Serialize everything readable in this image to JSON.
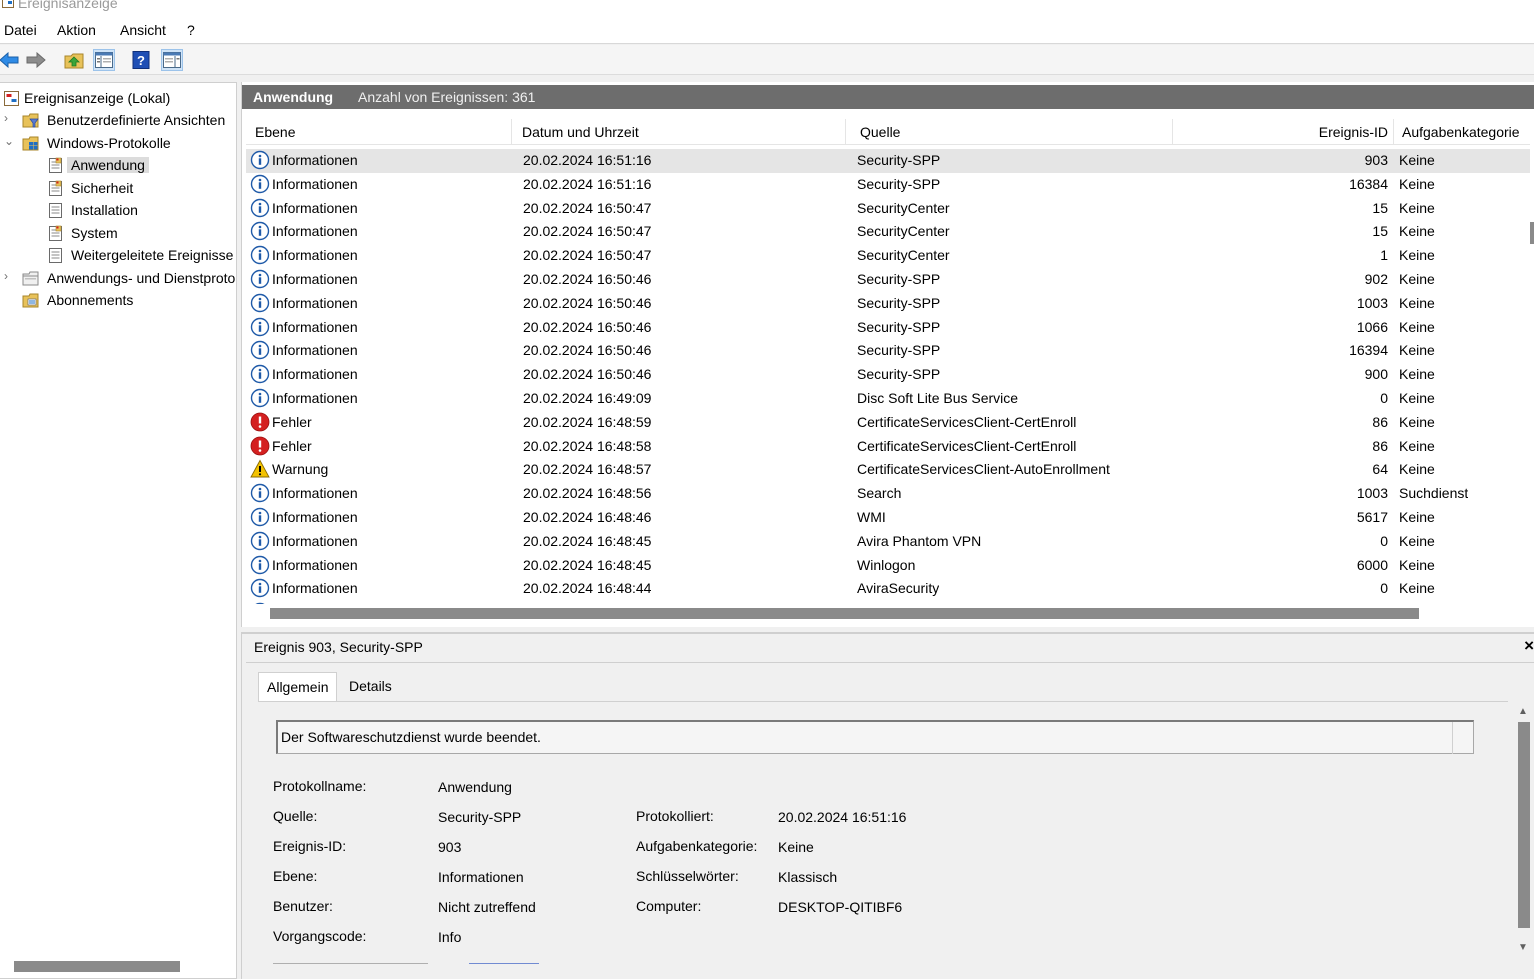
{
  "window": {
    "title": "Ereignisanzeige"
  },
  "menu": {
    "items": [
      "Datei",
      "Aktion",
      "Ansicht",
      "?"
    ]
  },
  "toolbar": {
    "buttons": [
      "back-arrow-icon",
      "forward-arrow-icon",
      "folder-up-icon",
      "show-hide-console-tree-icon",
      "help-icon",
      "show-hide-action-pane-icon"
    ]
  },
  "tree": {
    "items": [
      {
        "label": "Ereignisanzeige (Lokal)",
        "icon": "event-viewer-icon",
        "level": 0,
        "expander": ""
      },
      {
        "label": "Benutzerdefinierte Ansichten",
        "icon": "folder-filter-icon",
        "level": 1,
        "expander": "›"
      },
      {
        "label": "Windows-Protokolle",
        "icon": "folder-windows-icon",
        "level": 1,
        "expander": "⌄"
      },
      {
        "label": "Anwendung",
        "icon": "log-icon",
        "level": 2,
        "expander": "",
        "selected": true
      },
      {
        "label": "Sicherheit",
        "icon": "log-icon",
        "level": 2,
        "expander": ""
      },
      {
        "label": "Installation",
        "icon": "log-plain-icon",
        "level": 2,
        "expander": ""
      },
      {
        "label": "System",
        "icon": "log-icon",
        "level": 2,
        "expander": ""
      },
      {
        "label": "Weitergeleitete Ereignisse",
        "icon": "log-plain-icon",
        "level": 2,
        "expander": ""
      },
      {
        "label": "Anwendungs- und Dienstprotokolle",
        "icon": "folder-icon",
        "level": 1,
        "expander": "›"
      },
      {
        "label": "Abonnements",
        "icon": "subscriptions-icon",
        "level": 1,
        "expander": ""
      }
    ]
  },
  "list": {
    "log_name": "Anwendung",
    "event_count": "Anzahl von Ereignissen: 361",
    "columns": [
      "Ebene",
      "Datum und Uhrzeit",
      "Quelle",
      "Ereignis-ID",
      "Aufgabenkategorie"
    ],
    "rows": [
      {
        "level": "Informationen",
        "type": "info",
        "date": "20.02.2024 16:51:16",
        "source": "Security-SPP",
        "id": "903",
        "category": "Keine"
      },
      {
        "level": "Informationen",
        "type": "info",
        "date": "20.02.2024 16:51:16",
        "source": "Security-SPP",
        "id": "16384",
        "category": "Keine"
      },
      {
        "level": "Informationen",
        "type": "info",
        "date": "20.02.2024 16:50:47",
        "source": "SecurityCenter",
        "id": "15",
        "category": "Keine"
      },
      {
        "level": "Informationen",
        "type": "info",
        "date": "20.02.2024 16:50:47",
        "source": "SecurityCenter",
        "id": "15",
        "category": "Keine"
      },
      {
        "level": "Informationen",
        "type": "info",
        "date": "20.02.2024 16:50:47",
        "source": "SecurityCenter",
        "id": "1",
        "category": "Keine"
      },
      {
        "level": "Informationen",
        "type": "info",
        "date": "20.02.2024 16:50:46",
        "source": "Security-SPP",
        "id": "902",
        "category": "Keine"
      },
      {
        "level": "Informationen",
        "type": "info",
        "date": "20.02.2024 16:50:46",
        "source": "Security-SPP",
        "id": "1003",
        "category": "Keine"
      },
      {
        "level": "Informationen",
        "type": "info",
        "date": "20.02.2024 16:50:46",
        "source": "Security-SPP",
        "id": "1066",
        "category": "Keine"
      },
      {
        "level": "Informationen",
        "type": "info",
        "date": "20.02.2024 16:50:46",
        "source": "Security-SPP",
        "id": "16394",
        "category": "Keine"
      },
      {
        "level": "Informationen",
        "type": "info",
        "date": "20.02.2024 16:50:46",
        "source": "Security-SPP",
        "id": "900",
        "category": "Keine"
      },
      {
        "level": "Informationen",
        "type": "info",
        "date": "20.02.2024 16:49:09",
        "source": "Disc Soft Lite Bus Service",
        "id": "0",
        "category": "Keine"
      },
      {
        "level": "Fehler",
        "type": "error",
        "date": "20.02.2024 16:48:59",
        "source": "CertificateServicesClient-CertEnroll",
        "id": "86",
        "category": "Keine"
      },
      {
        "level": "Fehler",
        "type": "error",
        "date": "20.02.2024 16:48:58",
        "source": "CertificateServicesClient-CertEnroll",
        "id": "86",
        "category": "Keine"
      },
      {
        "level": "Warnung",
        "type": "warning",
        "date": "20.02.2024 16:48:57",
        "source": "CertificateServicesClient-AutoEnrollment",
        "id": "64",
        "category": "Keine"
      },
      {
        "level": "Informationen",
        "type": "info",
        "date": "20.02.2024 16:48:56",
        "source": "Search",
        "id": "1003",
        "category": "Suchdienst"
      },
      {
        "level": "Informationen",
        "type": "info",
        "date": "20.02.2024 16:48:46",
        "source": "WMI",
        "id": "5617",
        "category": "Keine"
      },
      {
        "level": "Informationen",
        "type": "info",
        "date": "20.02.2024 16:48:45",
        "source": "Avira Phantom VPN",
        "id": "0",
        "category": "Keine"
      },
      {
        "level": "Informationen",
        "type": "info",
        "date": "20.02.2024 16:48:45",
        "source": "Winlogon",
        "id": "6000",
        "category": "Keine"
      },
      {
        "level": "Informationen",
        "type": "info",
        "date": "20.02.2024 16:48:44",
        "source": "AviraSecurity",
        "id": "0",
        "category": "Keine"
      }
    ]
  },
  "detail": {
    "title": "Ereignis 903, Security-SPP",
    "close": "×",
    "tabs": [
      "Allgemein",
      "Details"
    ],
    "description": "Der Softwareschutzdienst wurde beendet.",
    "fields_left": [
      {
        "label": "Protokollname:",
        "value": "Anwendung"
      },
      {
        "label": "Quelle:",
        "value": "Security-SPP"
      },
      {
        "label": "Ereignis-ID:",
        "value": "903"
      },
      {
        "label": "Ebene:",
        "value": "Informationen"
      },
      {
        "label": "Benutzer:",
        "value": "Nicht zutreffend"
      },
      {
        "label": "Vorgangscode:",
        "value": "Info"
      }
    ],
    "fields_right": [
      {
        "label": "Protokolliert:",
        "value": "20.02.2024 16:51:16"
      },
      {
        "label": "Aufgabenkategorie:",
        "value": "Keine"
      },
      {
        "label": "Schlüsselwörter:",
        "value": "Klassisch"
      },
      {
        "label": "Computer:",
        "value": "DESKTOP-QITIBF6"
      }
    ]
  },
  "colors": {
    "accent_blue": "#1f6fc4",
    "error_red": "#d42020",
    "warning_yellow": "#f3c200",
    "header_gray": "#6d6d6d",
    "link_blue": "#0645ad"
  }
}
